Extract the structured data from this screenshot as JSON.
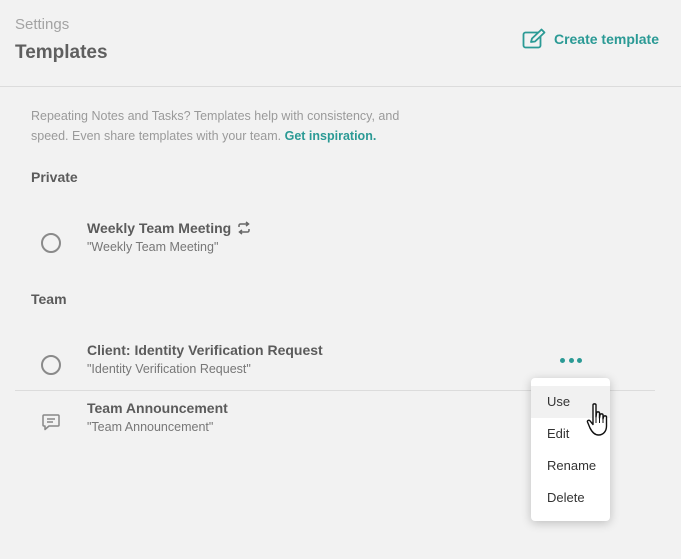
{
  "header": {
    "breadcrumb": "Settings",
    "title": "Templates",
    "create_label": "Create template"
  },
  "intro": {
    "text": "Repeating Notes and Tasks? Templates help with consistency, and speed. Even share templates with your team.",
    "link": "Get inspiration."
  },
  "sections": {
    "private": {
      "label": "Private",
      "items": [
        {
          "title": "Weekly Team Meeting",
          "subtitle": "\"Weekly Team Meeting\"",
          "icon": "radio-circle",
          "badge_icon": "repeat-icon"
        }
      ]
    },
    "team": {
      "label": "Team",
      "items": [
        {
          "title": "Client: Identity Verification Request",
          "subtitle": "\"Identity Verification Request\"",
          "icon": "radio-circle"
        },
        {
          "title": "Team Announcement",
          "subtitle": "\"Team Announcement\"",
          "icon": "chat-bubble-icon"
        }
      ]
    }
  },
  "context_menu": {
    "items": [
      "Use",
      "Edit",
      "Rename",
      "Delete"
    ],
    "hovered": "Use"
  },
  "colors": {
    "accent": "#2b9a95",
    "background": "#f2f2f2"
  }
}
